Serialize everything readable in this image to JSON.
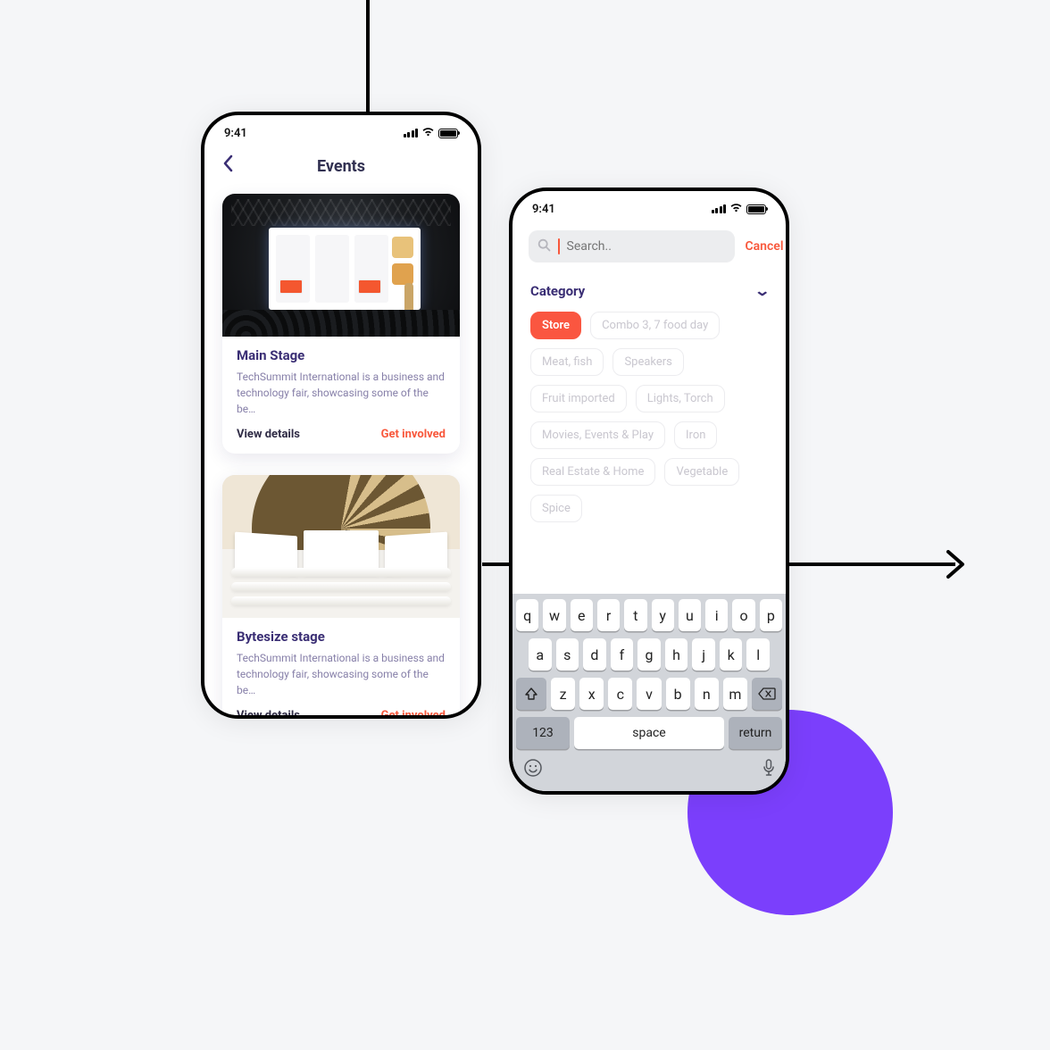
{
  "status": {
    "time": "9:41"
  },
  "phone1": {
    "header_title": "Events",
    "cards": [
      {
        "title": "Main Stage",
        "desc": "TechSummit International is a business and technology fair, showcasing some of the be…",
        "view": "View details",
        "cta": "Get involved"
      },
      {
        "title": "Bytesize stage",
        "desc": "TechSummit International is a business and technology fair, showcasing some of the be…",
        "view": "View details",
        "cta": "Get involved"
      }
    ]
  },
  "phone2": {
    "search_placeholder": "Search..",
    "cancel": "Cancel",
    "category_label": "Category",
    "chips": [
      "Store",
      "Combo 3, 7 food day",
      "Meat, fish",
      "Speakers",
      "Fruit imported",
      "Lights, Torch",
      "Movies, Events & Play",
      "Iron",
      "Real Estate & Home",
      "Vegetable",
      "Spice"
    ],
    "active_chip": "Store",
    "keyboard": {
      "row1": [
        "q",
        "w",
        "e",
        "r",
        "t",
        "y",
        "u",
        "i",
        "o",
        "p"
      ],
      "row2": [
        "a",
        "s",
        "d",
        "f",
        "g",
        "h",
        "j",
        "k",
        "l"
      ],
      "row3": [
        "z",
        "x",
        "c",
        "v",
        "b",
        "n",
        "m"
      ],
      "bottom": {
        "sym": "123",
        "space": "space",
        "return": "return"
      }
    }
  }
}
